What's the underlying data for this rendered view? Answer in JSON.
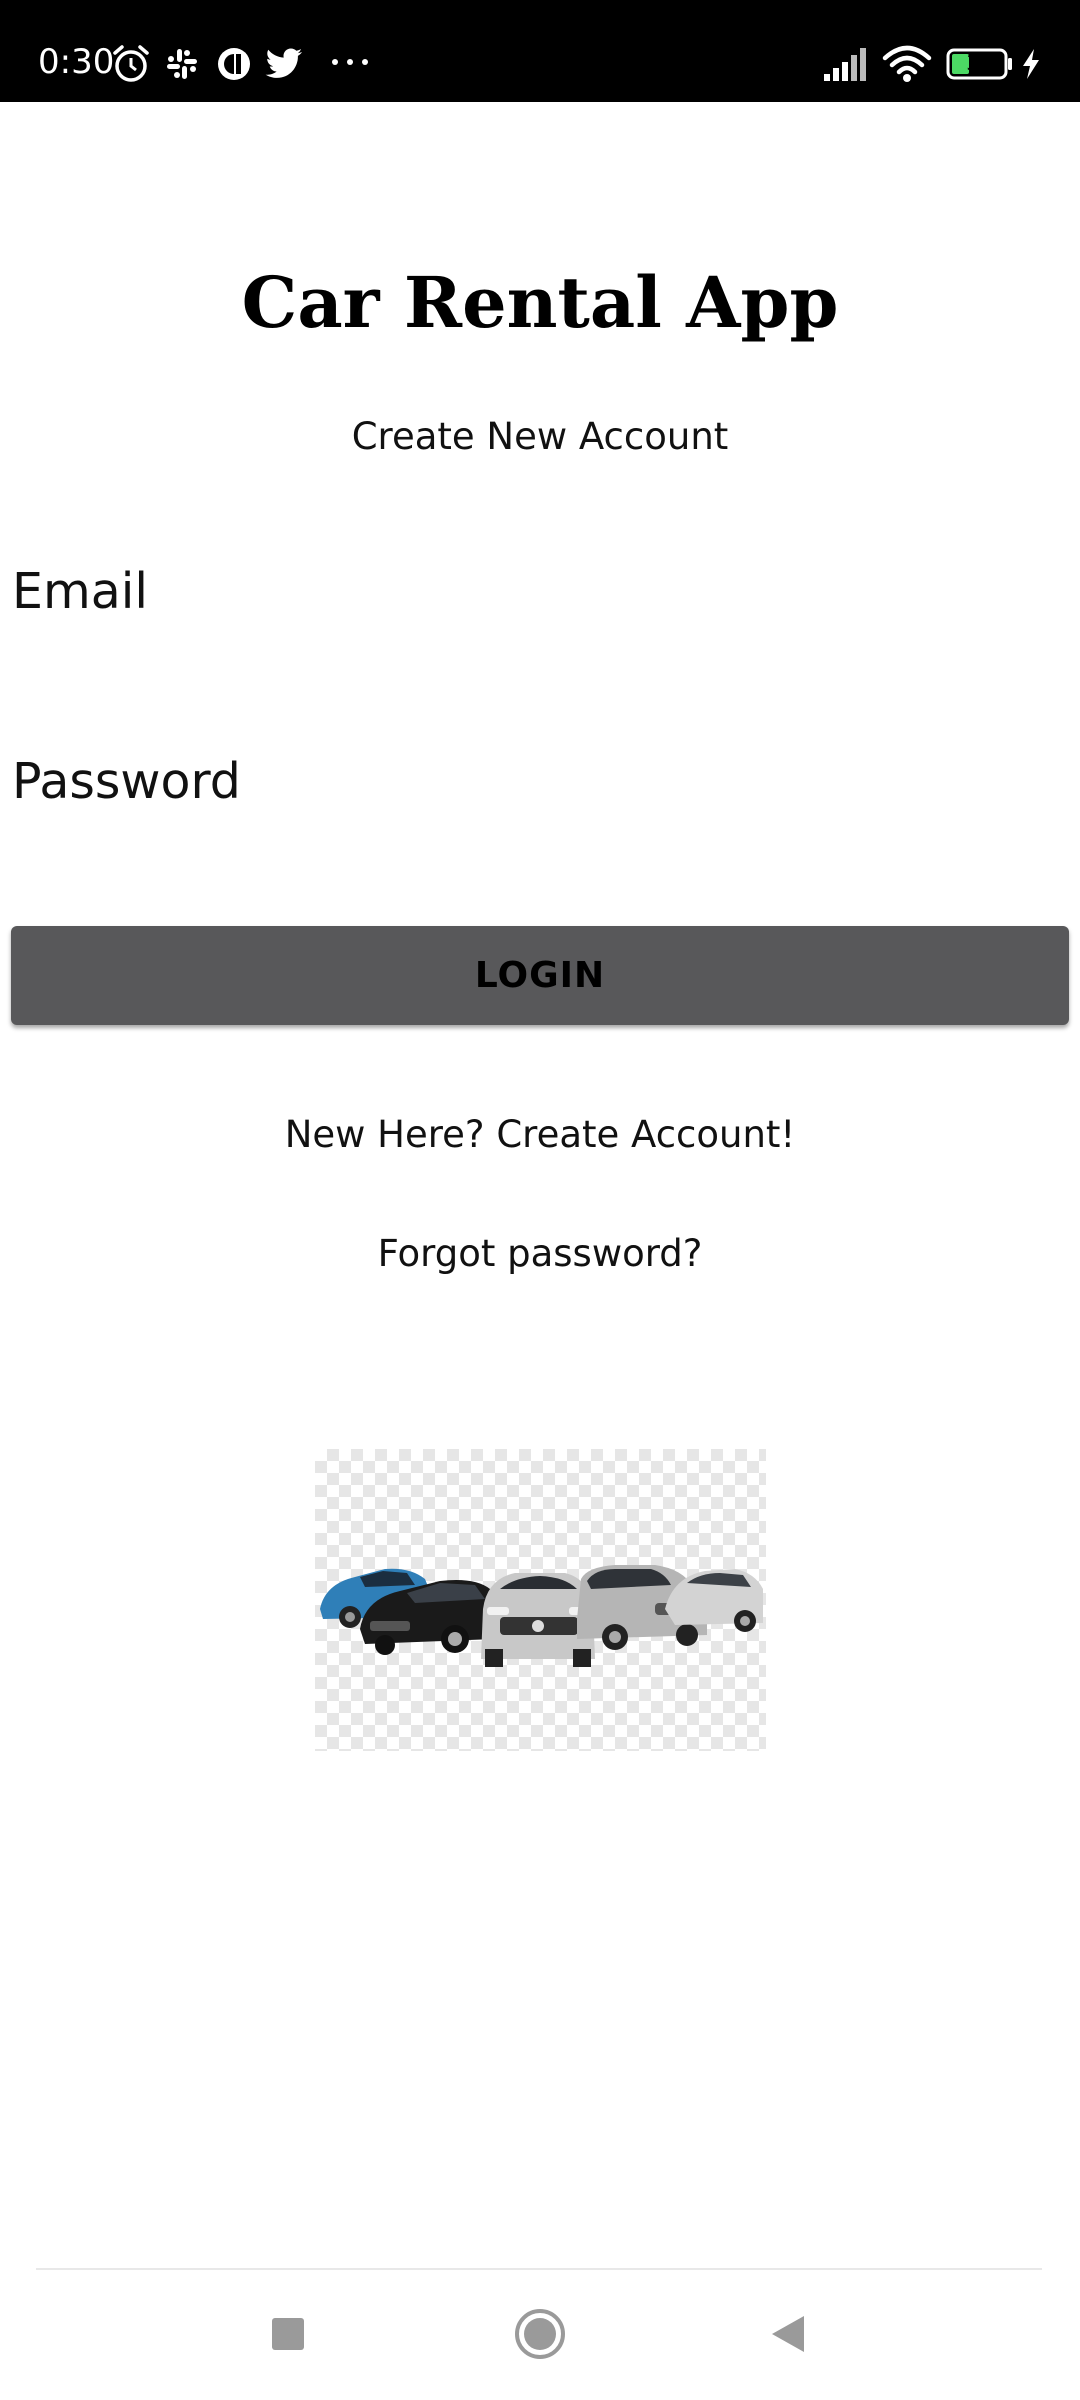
{
  "status_bar": {
    "time": "0:30",
    "battery_level": "33",
    "icons": [
      "alarm-icon",
      "slack-icon",
      "circle-app-icon",
      "twitter-icon",
      "more-dots-icon",
      "signal-icon",
      "wifi-icon",
      "battery-icon",
      "charging-icon"
    ]
  },
  "app": {
    "title": "Car Rental App",
    "subtitle": "Create New Account"
  },
  "form": {
    "email_label": "Email",
    "email_value": "",
    "password_label": "Password",
    "password_value": "",
    "login_label": "LOGIN"
  },
  "links": {
    "create_account": "New Here? Create Account!",
    "forgot_password": "Forgot password?"
  },
  "colors": {
    "status_bar_bg": "#000000",
    "button_bg": "#58585a",
    "battery_fill": "#4cd964"
  },
  "nav_bar": {
    "icons": [
      "recents-icon",
      "home-icon",
      "back-icon"
    ]
  }
}
